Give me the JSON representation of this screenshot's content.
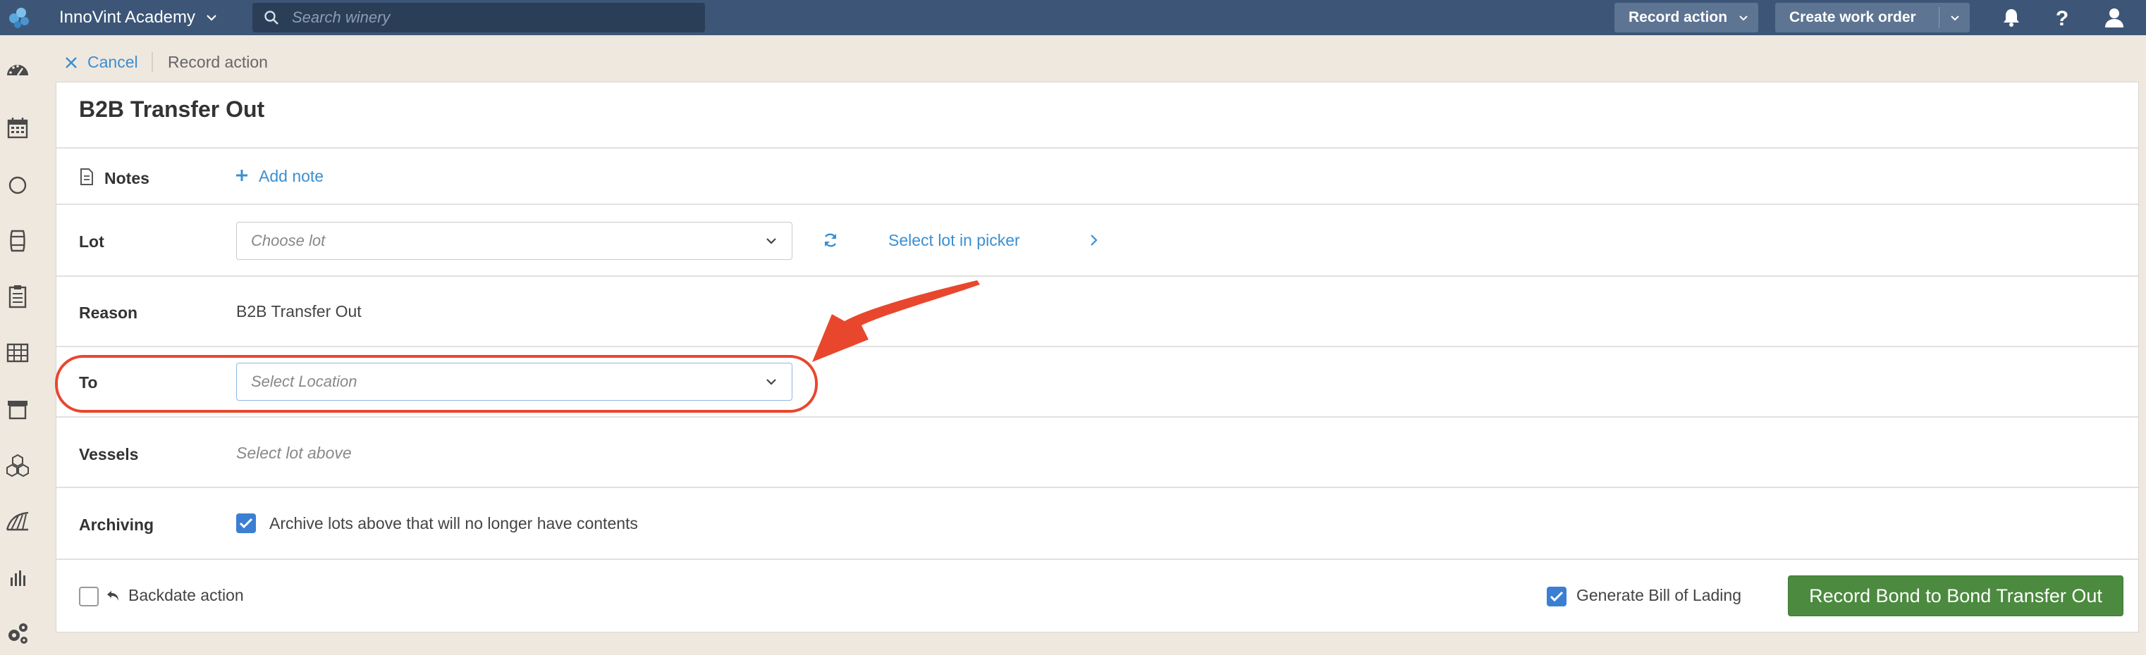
{
  "header": {
    "org_name": "InnoVint Academy",
    "search_placeholder": "Search winery",
    "record_action_label": "Record action",
    "create_work_order_label": "Create work order"
  },
  "breadcrumb": {
    "cancel_label": "Cancel",
    "current": "Record action"
  },
  "form": {
    "title": "B2B Transfer Out",
    "notes_label": "Notes",
    "add_note_label": "Add note",
    "lot_label": "Lot",
    "lot_placeholder": "Choose lot",
    "select_in_picker_label": "Select lot in picker",
    "reason_label": "Reason",
    "reason_value": "B2B Transfer Out",
    "to_label": "To",
    "to_placeholder": "Select Location",
    "vessels_label": "Vessels",
    "vessels_value": "Select lot above",
    "archiving_label": "Archiving",
    "archiving_checkbox_label": "Archive lots above that will no longer have contents",
    "archiving_checked": true
  },
  "footer": {
    "backdate_label": "Backdate action",
    "backdate_checked": false,
    "generate_bol_label": "Generate Bill of Lading",
    "generate_bol_checked": true,
    "submit_label": "Record Bond to Bond Transfer Out"
  },
  "sidebar_icons": [
    "dashboard-icon",
    "calendar-icon",
    "circle-icon",
    "barrel-icon",
    "clipboard-icon",
    "grid-icon",
    "archive-icon",
    "cubes-icon",
    "vineyard-icon",
    "bar-chart-icon",
    "settings-icon"
  ],
  "colors": {
    "topbar": "#3d5677",
    "link": "#3a8fd1",
    "primary_button": "#4b8a3f",
    "annotation": "#e8472e",
    "checkbox": "#3b7fd3"
  }
}
